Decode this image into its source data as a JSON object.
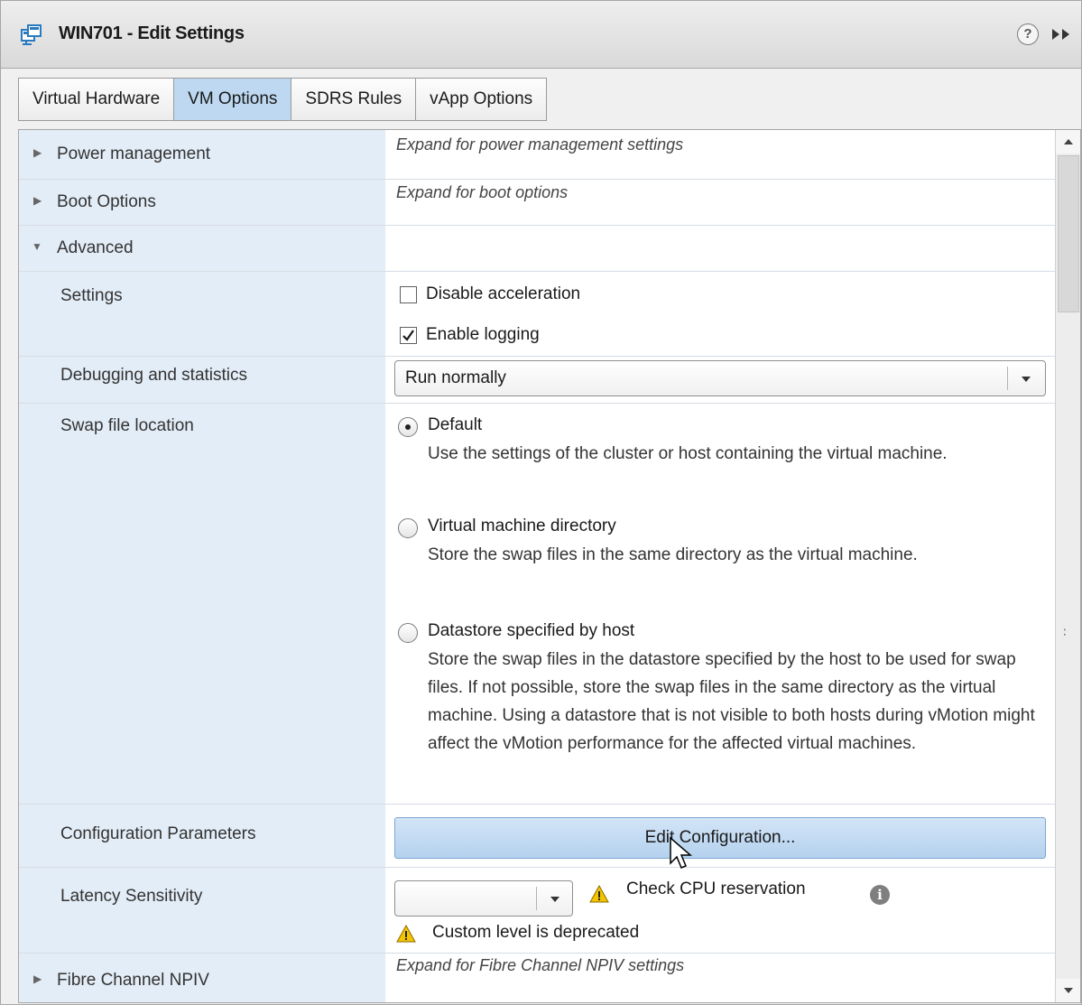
{
  "window": {
    "title": "WIN701 - Edit Settings",
    "help_icon": "question-mark-icon",
    "help_glyph": "?",
    "expand_icon": "double-chevron-right-icon"
  },
  "tabs": [
    {
      "label": "Virtual Hardware",
      "active": false
    },
    {
      "label": "VM Options",
      "active": true
    },
    {
      "label": "SDRS Rules",
      "active": false
    },
    {
      "label": "vApp Options",
      "active": false
    }
  ],
  "rows": {
    "power": {
      "label": "Power management",
      "hint": "Expand for power management settings",
      "expanded": false
    },
    "boot": {
      "label": "Boot Options",
      "hint": "Expand for boot options",
      "expanded": false
    },
    "advanced": {
      "label": "Advanced",
      "expanded": true
    },
    "settings": {
      "label": "Settings",
      "disable_acceleration": {
        "label": "Disable acceleration",
        "checked": false
      },
      "enable_logging": {
        "label": "Enable logging",
        "checked": true
      }
    },
    "debugging": {
      "label": "Debugging and statistics",
      "selected": "Run normally"
    },
    "swap": {
      "label": "Swap file location",
      "options": [
        {
          "label": "Default",
          "description": "Use the settings of the cluster or host containing the virtual machine.",
          "selected": true
        },
        {
          "label": "Virtual machine directory",
          "description": "Store the swap files in the same directory as the virtual machine.",
          "selected": false
        },
        {
          "label": "Datastore specified by host",
          "description": "Store the swap files in the datastore specified by the host to be used for swap files. If not possible, store the swap files in the same directory as the virtual machine. Using a datastore that is not visible to both hosts during vMotion might affect the vMotion performance for the affected virtual machines.",
          "selected": false
        }
      ]
    },
    "config": {
      "label": "Configuration Parameters",
      "button": "Edit Configuration..."
    },
    "latency": {
      "label": "Latency Sensitivity",
      "selected": "",
      "warning": "Check CPU reservation",
      "info_glyph": "i",
      "deprecated": "Custom level is deprecated"
    },
    "fibre": {
      "label": "Fibre Channel NPIV",
      "hint": "Expand for Fibre Channel NPIV settings",
      "expanded": false
    }
  },
  "colors": {
    "active_tab": "#bdd8f0",
    "label_column": "#e3edf7",
    "button": "#c4dcf3",
    "warning": "#f5c400"
  }
}
